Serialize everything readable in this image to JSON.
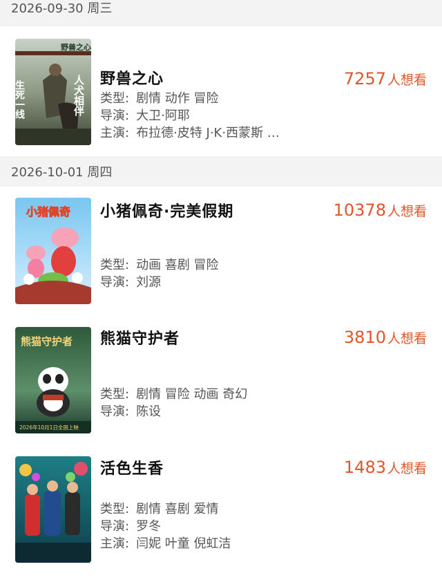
{
  "sections": [
    {
      "date": "2026-09-30 周三",
      "movies": [
        {
          "title": "野兽之心",
          "wants": "7257",
          "wants_label": "人想看",
          "genre_label": "类型:",
          "genre": "剧情 动作 冒险",
          "director_label": "导演:",
          "director": "大卫·阿耶",
          "cast_label": "主演:",
          "cast": "布拉德·皮特 J·K·西蒙斯 …",
          "poster_text_1": "野兽之心",
          "poster_text_left": "生死一线",
          "poster_text_right": "人犬相伴"
        }
      ]
    },
    {
      "date": "2026-10-01 周四",
      "movies": [
        {
          "title": "小猪佩奇·完美假期",
          "wants": "10378",
          "wants_label": "人想看",
          "genre_label": "类型:",
          "genre": "动画 喜剧 冒险",
          "director_label": "导演:",
          "director": "刘源",
          "poster_text_1": "小猪佩奇"
        },
        {
          "title": "熊猫守护者",
          "wants": "3810",
          "wants_label": "人想看",
          "genre_label": "类型:",
          "genre": "剧情 冒险 动画 奇幻",
          "director_label": "导演:",
          "director": "陈设",
          "poster_text_1": "熊猫守护者",
          "poster_text_2": "2026年10月1日全国上映"
        },
        {
          "title": "活色生香",
          "wants": "1483",
          "wants_label": "人想看",
          "genre_label": "类型:",
          "genre": "剧情 喜剧 爱情",
          "director_label": "导演:",
          "director": "罗冬",
          "cast_label": "主演:",
          "cast": "闫妮 叶童 倪虹洁"
        }
      ]
    }
  ],
  "colors": {
    "accent": "#e0562a",
    "header_bg": "#f3f3f3"
  }
}
